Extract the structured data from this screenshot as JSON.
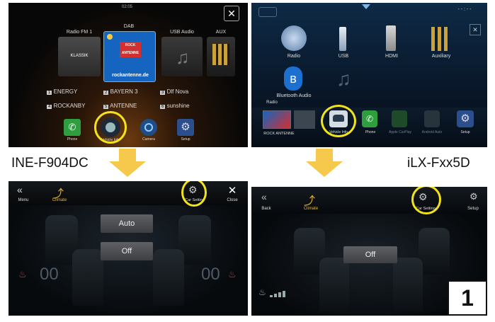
{
  "top_left": {
    "time": "02:05",
    "sources": [
      "Radio FM 1",
      "DAB",
      "USB Audio",
      "AUX"
    ],
    "radio_tile_text": "KLASSIK",
    "dab_tile_text": "ROCK ANTENNE",
    "dab_url": "rockantenne.de",
    "presets": [
      {
        "num": "1",
        "name": "ENERGY"
      },
      {
        "num": "2",
        "name": "BAYERN 3"
      },
      {
        "num": "3",
        "name": "Dlf Nova"
      },
      {
        "num": "4",
        "name": "ROCKANBY"
      },
      {
        "num": "5",
        "name": "ANTENNE"
      },
      {
        "num": "6",
        "name": "sunshine"
      }
    ],
    "dock": [
      "Phone",
      "Vehicle Info",
      "Camera",
      "Setup"
    ]
  },
  "top_right": {
    "sources": [
      "Radio",
      "USB",
      "HDMI",
      "Auxiliary",
      "Bluetooth Audio"
    ],
    "now_playing_label": "Radio",
    "now_playing_station": "ROCK ANTENNE",
    "dock": [
      "Vehicle Info",
      "Phone",
      "Apple CarPlay",
      "Android Auto",
      "Setup"
    ]
  },
  "models": {
    "left": "INE-F904DC",
    "right": "iLX-Fxx5D"
  },
  "bottom_left": {
    "menu": "Menu",
    "climate": "Climate",
    "car_setting": "Car Setting",
    "close": "Close",
    "auto": "Auto",
    "off": "Off",
    "temp_left": "00",
    "temp_right": "00"
  },
  "bottom_right": {
    "back": "Back",
    "climate": "Climate",
    "car_setting": "Car Setting",
    "setup": "Setup",
    "off": "Off"
  },
  "step_number": "1",
  "colors": {
    "highlight_ring": "#f2e21a",
    "arrow": "#f6c94c",
    "climate_accent": "#e8b424"
  }
}
